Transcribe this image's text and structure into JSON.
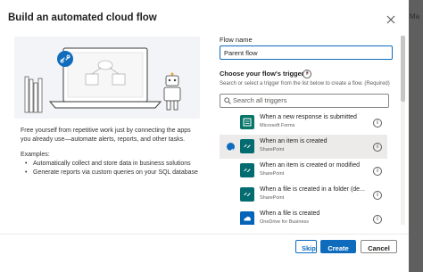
{
  "background": {
    "partial_text": "Ma"
  },
  "dialog": {
    "title": "Build an automated cloud flow",
    "description": "Free yourself from repetitive work just by connecting the apps you already use—automate alerts, reports, and other tasks.",
    "examples_title": "Examples:",
    "examples": [
      "Automatically collect and store data in business solutions",
      "Generate reports via custom queries on your SQL database"
    ],
    "flow_name_label": "Flow name",
    "flow_name_value": "Parent flow",
    "trigger_label": "Choose your flow's trigger",
    "trigger_required": "*",
    "trigger_hint": "Search or select a trigger from the list below to create a flow. (Required)",
    "search_placeholder": "Search all triggers",
    "triggers": [
      {
        "name": "When a new response is submitted",
        "app": "Microsoft Forms",
        "icon": "forms-icon",
        "color": "#077568",
        "selected": false
      },
      {
        "name": "When an item is created",
        "app": "SharePoint",
        "icon": "sharepoint-icon",
        "color": "#036c70",
        "selected": true
      },
      {
        "name": "When an item is created or modified",
        "app": "SharePoint",
        "icon": "sharepoint-icon",
        "color": "#036c70",
        "selected": false
      },
      {
        "name": "When a file is created in a folder (de...",
        "app": "SharePoint",
        "icon": "sharepoint-icon",
        "color": "#036c70",
        "selected": false
      },
      {
        "name": "When a file is created",
        "app": "OneDrive for Business",
        "icon": "onedrive-icon",
        "color": "#0364b8",
        "selected": false
      }
    ],
    "buttons": {
      "skip": "Skip",
      "create": "Create",
      "cancel": "Cancel"
    },
    "colors": {
      "accent": "#0f6cbd",
      "illustration_bg": "#f3f4f7"
    }
  }
}
